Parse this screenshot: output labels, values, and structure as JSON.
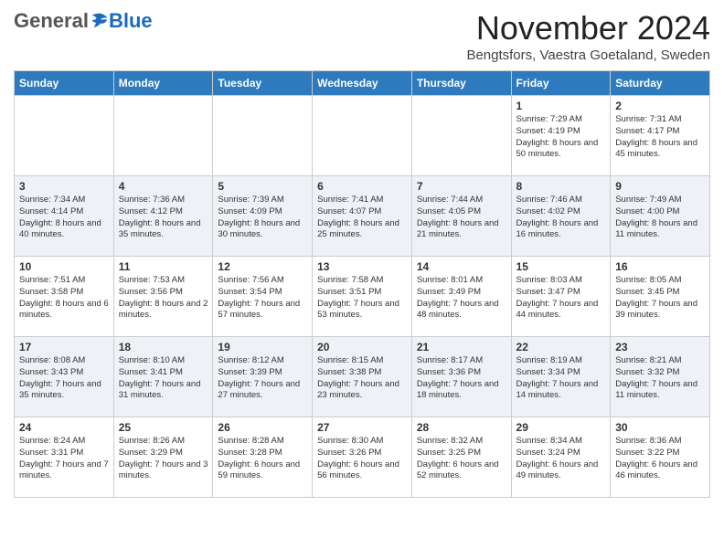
{
  "logo": {
    "general": "General",
    "blue": "Blue"
  },
  "header": {
    "month": "November 2024",
    "location": "Bengtsfors, Vaestra Goetaland, Sweden"
  },
  "weekdays": [
    "Sunday",
    "Monday",
    "Tuesday",
    "Wednesday",
    "Thursday",
    "Friday",
    "Saturday"
  ],
  "weeks": [
    [
      {
        "day": "",
        "info": ""
      },
      {
        "day": "",
        "info": ""
      },
      {
        "day": "",
        "info": ""
      },
      {
        "day": "",
        "info": ""
      },
      {
        "day": "",
        "info": ""
      },
      {
        "day": "1",
        "info": "Sunrise: 7:29 AM\nSunset: 4:19 PM\nDaylight: 8 hours and 50 minutes."
      },
      {
        "day": "2",
        "info": "Sunrise: 7:31 AM\nSunset: 4:17 PM\nDaylight: 8 hours and 45 minutes."
      }
    ],
    [
      {
        "day": "3",
        "info": "Sunrise: 7:34 AM\nSunset: 4:14 PM\nDaylight: 8 hours and 40 minutes."
      },
      {
        "day": "4",
        "info": "Sunrise: 7:36 AM\nSunset: 4:12 PM\nDaylight: 8 hours and 35 minutes."
      },
      {
        "day": "5",
        "info": "Sunrise: 7:39 AM\nSunset: 4:09 PM\nDaylight: 8 hours and 30 minutes."
      },
      {
        "day": "6",
        "info": "Sunrise: 7:41 AM\nSunset: 4:07 PM\nDaylight: 8 hours and 25 minutes."
      },
      {
        "day": "7",
        "info": "Sunrise: 7:44 AM\nSunset: 4:05 PM\nDaylight: 8 hours and 21 minutes."
      },
      {
        "day": "8",
        "info": "Sunrise: 7:46 AM\nSunset: 4:02 PM\nDaylight: 8 hours and 16 minutes."
      },
      {
        "day": "9",
        "info": "Sunrise: 7:49 AM\nSunset: 4:00 PM\nDaylight: 8 hours and 11 minutes."
      }
    ],
    [
      {
        "day": "10",
        "info": "Sunrise: 7:51 AM\nSunset: 3:58 PM\nDaylight: 8 hours and 6 minutes."
      },
      {
        "day": "11",
        "info": "Sunrise: 7:53 AM\nSunset: 3:56 PM\nDaylight: 8 hours and 2 minutes."
      },
      {
        "day": "12",
        "info": "Sunrise: 7:56 AM\nSunset: 3:54 PM\nDaylight: 7 hours and 57 minutes."
      },
      {
        "day": "13",
        "info": "Sunrise: 7:58 AM\nSunset: 3:51 PM\nDaylight: 7 hours and 53 minutes."
      },
      {
        "day": "14",
        "info": "Sunrise: 8:01 AM\nSunset: 3:49 PM\nDaylight: 7 hours and 48 minutes."
      },
      {
        "day": "15",
        "info": "Sunrise: 8:03 AM\nSunset: 3:47 PM\nDaylight: 7 hours and 44 minutes."
      },
      {
        "day": "16",
        "info": "Sunrise: 8:05 AM\nSunset: 3:45 PM\nDaylight: 7 hours and 39 minutes."
      }
    ],
    [
      {
        "day": "17",
        "info": "Sunrise: 8:08 AM\nSunset: 3:43 PM\nDaylight: 7 hours and 35 minutes."
      },
      {
        "day": "18",
        "info": "Sunrise: 8:10 AM\nSunset: 3:41 PM\nDaylight: 7 hours and 31 minutes."
      },
      {
        "day": "19",
        "info": "Sunrise: 8:12 AM\nSunset: 3:39 PM\nDaylight: 7 hours and 27 minutes."
      },
      {
        "day": "20",
        "info": "Sunrise: 8:15 AM\nSunset: 3:38 PM\nDaylight: 7 hours and 23 minutes."
      },
      {
        "day": "21",
        "info": "Sunrise: 8:17 AM\nSunset: 3:36 PM\nDaylight: 7 hours and 18 minutes."
      },
      {
        "day": "22",
        "info": "Sunrise: 8:19 AM\nSunset: 3:34 PM\nDaylight: 7 hours and 14 minutes."
      },
      {
        "day": "23",
        "info": "Sunrise: 8:21 AM\nSunset: 3:32 PM\nDaylight: 7 hours and 11 minutes."
      }
    ],
    [
      {
        "day": "24",
        "info": "Sunrise: 8:24 AM\nSunset: 3:31 PM\nDaylight: 7 hours and 7 minutes."
      },
      {
        "day": "25",
        "info": "Sunrise: 8:26 AM\nSunset: 3:29 PM\nDaylight: 7 hours and 3 minutes."
      },
      {
        "day": "26",
        "info": "Sunrise: 8:28 AM\nSunset: 3:28 PM\nDaylight: 6 hours and 59 minutes."
      },
      {
        "day": "27",
        "info": "Sunrise: 8:30 AM\nSunset: 3:26 PM\nDaylight: 6 hours and 56 minutes."
      },
      {
        "day": "28",
        "info": "Sunrise: 8:32 AM\nSunset: 3:25 PM\nDaylight: 6 hours and 52 minutes."
      },
      {
        "day": "29",
        "info": "Sunrise: 8:34 AM\nSunset: 3:24 PM\nDaylight: 6 hours and 49 minutes."
      },
      {
        "day": "30",
        "info": "Sunrise: 8:36 AM\nSunset: 3:22 PM\nDaylight: 6 hours and 46 minutes."
      }
    ]
  ]
}
